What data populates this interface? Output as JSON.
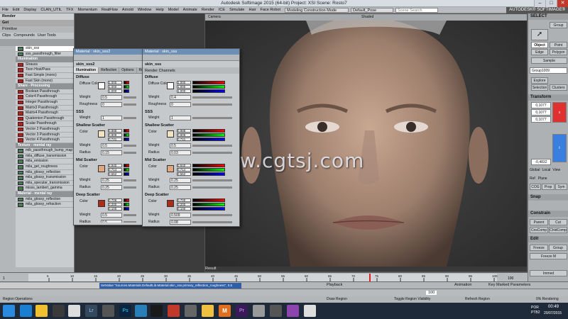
{
  "window": {
    "title": "Autodesk Softimage 2015 (64-bit)   Project: XSI   Scene: Rosto7"
  },
  "brand": "AUTODESK® SOFTIMAGE®",
  "menu": {
    "items": [
      "File",
      "Edit",
      "Display",
      "CLAN_UTIL",
      "TFX",
      "Momentum",
      "RealFlow",
      "Arnold",
      "Window",
      "Help",
      "Model",
      "Animate",
      "Render",
      "ICE",
      "Simulate",
      "Hair",
      "Face Robot"
    ],
    "mode_select": "Modeling Construction Mode",
    "pose_select": "Default_Pose",
    "search_placeholder": "Scene Search"
  },
  "left_panel": {
    "module": "Render",
    "get_label": "Get",
    "primitive_label": "Primitive",
    "toolbar": [
      "Clips",
      "Compounds",
      "User Tools"
    ],
    "items": [
      {
        "label": "skin_sss",
        "type": "sel"
      },
      {
        "label": "sss_passthrough_filter",
        "type": "g"
      },
      {
        "label": "Illumination",
        "type": "cat"
      },
      {
        "label": "Strauss",
        "type": "r"
      },
      {
        "label": "Toon Host/Pass",
        "type": "r"
      },
      {
        "label": "Fast Simple (mono)",
        "type": "r"
      },
      {
        "label": "Fast Skin (mono)",
        "type": "r"
      },
      {
        "label": "Share - Processing",
        "type": "cat"
      },
      {
        "label": "Boolean Passthrough",
        "type": "r"
      },
      {
        "label": "Color4 Passthrough",
        "type": "r"
      },
      {
        "label": "Integer Passthrough",
        "type": "r"
      },
      {
        "label": "Matrix3 Passthrough",
        "type": "r"
      },
      {
        "label": "Matrix4 Passthrough",
        "type": "r"
      },
      {
        "label": "Quaternion Passthrough",
        "type": "r"
      },
      {
        "label": "Scalar Passthrough",
        "type": "r"
      },
      {
        "label": "Vector 2 Passthrough",
        "type": "r"
      },
      {
        "label": "Vector 3 Passthrough",
        "type": "r"
      },
      {
        "label": "Vector 4 Passthrough",
        "type": "r"
      },
      {
        "label": "Texture - mental ray",
        "type": "cat"
      },
      {
        "label": "mib_passthrough_bump_map",
        "type": "g"
      },
      {
        "label": "mila_diffuse_transmission",
        "type": "g"
      },
      {
        "label": "mila_emission",
        "type": "g"
      },
      {
        "label": "mila_get_roughness",
        "type": "g"
      },
      {
        "label": "mila_glossy_reflection",
        "type": "g"
      },
      {
        "label": "mila_glossy_transmission",
        "type": "g"
      },
      {
        "label": "mila_specular_transmission",
        "type": "g"
      },
      {
        "label": "misss_lambert_gamma",
        "type": "g"
      },
      {
        "label": "Material - mental ray",
        "type": "cat"
      },
      {
        "label": "mila_glossy_reflection",
        "type": "g"
      },
      {
        "label": "mila_glossy_refraction",
        "type": "g"
      }
    ]
  },
  "ppg1": {
    "title": "Material : skin_sss2",
    "name": "skin_sss2",
    "tabs": [
      "Illumination",
      "Reflection",
      "Options",
      "Re"
    ],
    "diffuse_label": "Diffuse",
    "color_label": "Diffuse Color",
    "diffuse_rgb": [
      "1.000",
      "1.000",
      "1.000"
    ],
    "weight_label": "Weight",
    "weight": "0.5",
    "roughness_label": "Roughness",
    "roughness": "0",
    "sss_label": "SSS",
    "sss_weight": "1",
    "shallow_label": "Shallow Scatter",
    "shallow_rgb": [
      "0.988",
      "0.909",
      "0.741"
    ],
    "shallow_weight": "0.5",
    "shallow_radius": "0.15",
    "mid_label": "Mid Scatter",
    "mid_rgb": [
      "0.940",
      "0.714",
      "0.562"
    ],
    "mid_weight": "0.25",
    "mid_radius": "0.25",
    "deep_label": "Deep Scatter",
    "deep_rgb": [
      "0.706",
      "0.200",
      "0.100"
    ],
    "deep_weight": "0.5",
    "deep_radius": "0.5",
    "color": "Color",
    "radius": "Radius"
  },
  "ppg2": {
    "title": "Material : skin_sss",
    "name": "skin_sss",
    "channels_label": "Render Channels",
    "diffuse_label": "Diffuse",
    "color_label": "Diffuse Color",
    "diffuse_rgb": [
      "1.000",
      "1.000",
      "1.000"
    ],
    "weight": "0.4",
    "roughness": "0",
    "sss_label": "SSS",
    "sss_weight": "1",
    "shallow_label": "Shallow Scatter",
    "shallow_rgb": [
      "0.988",
      "0.909",
      "0.741"
    ],
    "shallow_weight": "0.5",
    "shallow_radius": "0.03",
    "mid_label": "Mid Scatter",
    "mid_rgb": [
      "0.940",
      "0.714",
      "0.562"
    ],
    "mid_weight": "0.25",
    "mid_radius": "0.25",
    "deep_label": "Deep Scatter",
    "deep_rgb": [
      "0.700",
      "0.200",
      "0.100"
    ],
    "deep_weight": "0.509",
    "deep_radius": "0.08",
    "color": "Color",
    "radius": "Radius",
    "weight_label": "Weight",
    "roughness_label": "Roughness"
  },
  "viewport": {
    "camera": "Camera",
    "shading": "Shaded",
    "result_label": "Result",
    "watermark": "www.cgtsj.com"
  },
  "right_panel": {
    "header": "SELECT",
    "buttons": [
      "Group",
      "Object",
      "Point",
      "Edge",
      "Polygon",
      "Sample",
      "Explore",
      "Selection",
      "Clusters"
    ],
    "field": "Group1009",
    "transform": "Transform",
    "tvals": [
      "0,1077",
      "0,1077",
      "0,1077"
    ],
    "rval": "-0,4832",
    "tabs": [
      "Global",
      "Local",
      "View",
      "Ref",
      "Plane"
    ],
    "cog": "COG",
    "prop": "Prop",
    "sym": "Sym",
    "snap": "Snap",
    "constrain": "Constrain",
    "parent": "Parent",
    "cut": "Cut",
    "cnscomp": "CnsComp",
    "childcomp": "ChldComp",
    "edit": "Edit",
    "freeze": "Freeze",
    "group": "Group",
    "freeze_m": "Freeze M",
    "immed": "Immed"
  },
  "timeline": {
    "start": "1",
    "end": "100",
    "current": "1",
    "ticks": [
      "5",
      "10",
      "15",
      "20",
      "25",
      "30",
      "35",
      "40",
      "45",
      "50",
      "55",
      "60",
      "65",
      "70",
      "75",
      "80",
      "85",
      "90",
      "95",
      "100"
    ]
  },
  "cmdline": {
    "text": "SetValue \"Sources.Materials.DefaultLib.Material.skin_sss.primary_reflection_roughness\", 0.5",
    "playback": "Playback",
    "animation": "Animation",
    "keyparams": "Key Marked Parameters",
    "frame": "100"
  },
  "status": {
    "region": "Region Operations",
    "draw": "Draw Region",
    "toggle": "Toggle Region Visibility",
    "refresh": "Refresh Region",
    "rendering": "0% Rendering"
  },
  "taskbar": {
    "lang": "POR\nPTB2",
    "time": "00:49",
    "date": "20/07/2015"
  }
}
